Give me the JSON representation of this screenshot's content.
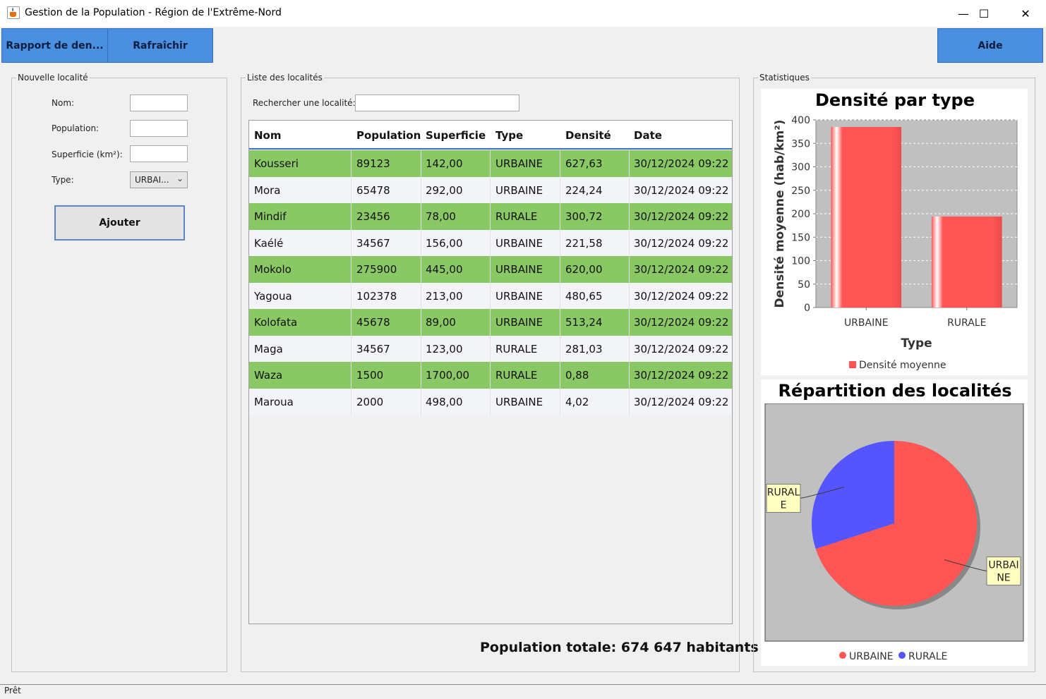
{
  "window": {
    "title": "Gestion de la Population - Région de l'Extrême-Nord",
    "controls": {
      "minimize": "—",
      "maximize": "☐",
      "close": "✕"
    }
  },
  "toolbar": {
    "report_label": "Rapport de den...",
    "refresh_label": "Rafraîchir",
    "help_label": "Aide"
  },
  "form": {
    "title": "Nouvelle localité",
    "name_label": "Nom:",
    "population_label": "Population:",
    "area_label": "Superficie (km²):",
    "type_label": "Type:",
    "type_value": "URBAI...",
    "add_label": "Ajouter"
  },
  "list": {
    "title": "Liste des localités",
    "search_label": "Rechercher une localité:",
    "columns": [
      "Nom",
      "Population",
      "Superficie",
      "Type",
      "Densité",
      "Date"
    ],
    "rows": [
      [
        "Kousseri",
        "89123",
        "142,00",
        "URBAINE",
        "627,63",
        "30/12/2024 09:22"
      ],
      [
        "Mora",
        "65478",
        "292,00",
        "URBAINE",
        "224,24",
        "30/12/2024 09:22"
      ],
      [
        "Mindif",
        "23456",
        "78,00",
        "RURALE",
        "300,72",
        "30/12/2024 09:22"
      ],
      [
        "Kaélé",
        "34567",
        "156,00",
        "URBAINE",
        "221,58",
        "30/12/2024 09:22"
      ],
      [
        "Mokolo",
        "275900",
        "445,00",
        "URBAINE",
        "620,00",
        "30/12/2024 09:22"
      ],
      [
        "Yagoua",
        "102378",
        "213,00",
        "URBAINE",
        "480,65",
        "30/12/2024 09:22"
      ],
      [
        "Kolofata",
        "45678",
        "89,00",
        "URBAINE",
        "513,24",
        "30/12/2024 09:22"
      ],
      [
        "Maga",
        "34567",
        "123,00",
        "RURALE",
        "281,03",
        "30/12/2024 09:22"
      ],
      [
        "Waza",
        "1500",
        "1700,00",
        "RURALE",
        "0,88",
        "30/12/2024 09:22"
      ],
      [
        "Maroua",
        "2000",
        "498,00",
        "URBAINE",
        "4,02",
        "30/12/2024 09:22"
      ]
    ],
    "total_label": "Population totale: 674 647 habitants"
  },
  "stats": {
    "title": "Statistiques"
  },
  "status": {
    "text": "Prêt"
  },
  "colors": {
    "accent_button": "#4a8fe0",
    "row_highlight": "#8ac865",
    "series_red": "#ff5555",
    "series_blue": "#5555ff"
  },
  "chart_data": [
    {
      "type": "bar",
      "title": "Densité par type",
      "xlabel": "Type",
      "ylabel": "Densité moyenne (hab/km²)",
      "categories": [
        "URBAINE",
        "RURALE"
      ],
      "series": [
        {
          "name": "Densité moyenne",
          "values": [
            385,
            194
          ]
        }
      ],
      "ylim": [
        0,
        400
      ],
      "yticks": [
        0,
        50,
        100,
        150,
        200,
        250,
        300,
        350,
        400
      ],
      "grid": true,
      "legend": "bottom"
    },
    {
      "type": "pie",
      "title": "Répartition des localités",
      "labels": [
        "URBAINE",
        "RURALE"
      ],
      "slice_labels": [
        "URBAI\nNE",
        "RURAL\nE"
      ],
      "values": [
        7,
        3
      ],
      "legend": "bottom"
    }
  ]
}
